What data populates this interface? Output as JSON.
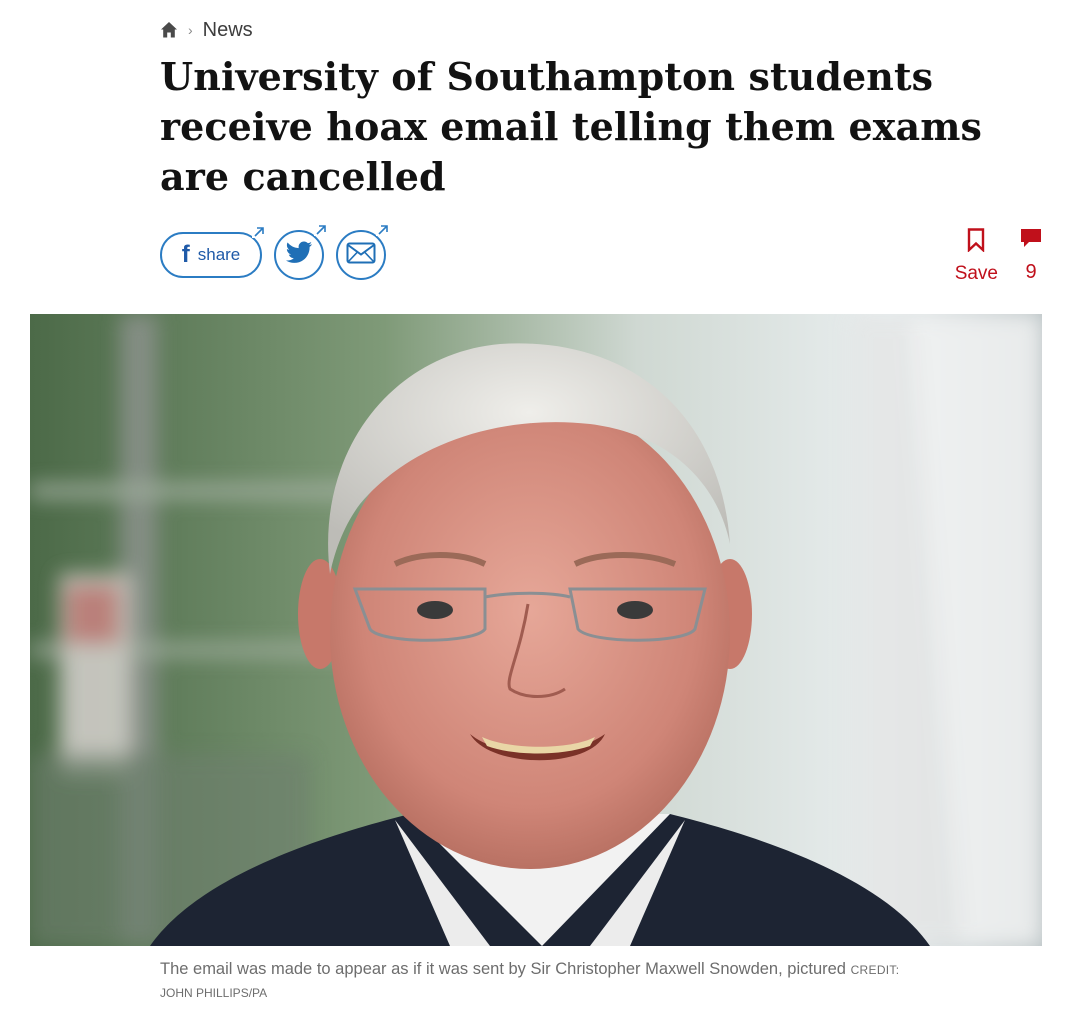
{
  "breadcrumb": {
    "home_icon": "home-icon",
    "separator": "›",
    "section": "News"
  },
  "headline": "University of Southampton students receive hoax email telling them exams are cancelled",
  "share": {
    "facebook_label": "share",
    "icons": [
      "facebook-icon",
      "twitter-icon",
      "email-icon",
      "external-arrow-icon"
    ]
  },
  "actions": {
    "save_label": "Save",
    "comment_count": "9",
    "icons": [
      "bookmark-icon",
      "comment-icon"
    ]
  },
  "image": {
    "caption": "The email was made to appear as if it was sent by Sir Christopher Maxwell Snowden, pictured",
    "credit_label": "CREDIT:",
    "credit_name": "JOHN PHILLIPS/PA"
  },
  "colors": {
    "headline": "#121212",
    "share_blue": "#2b7cc3",
    "accent_red": "#c0101b",
    "caption_grey": "#6d6d6d"
  }
}
